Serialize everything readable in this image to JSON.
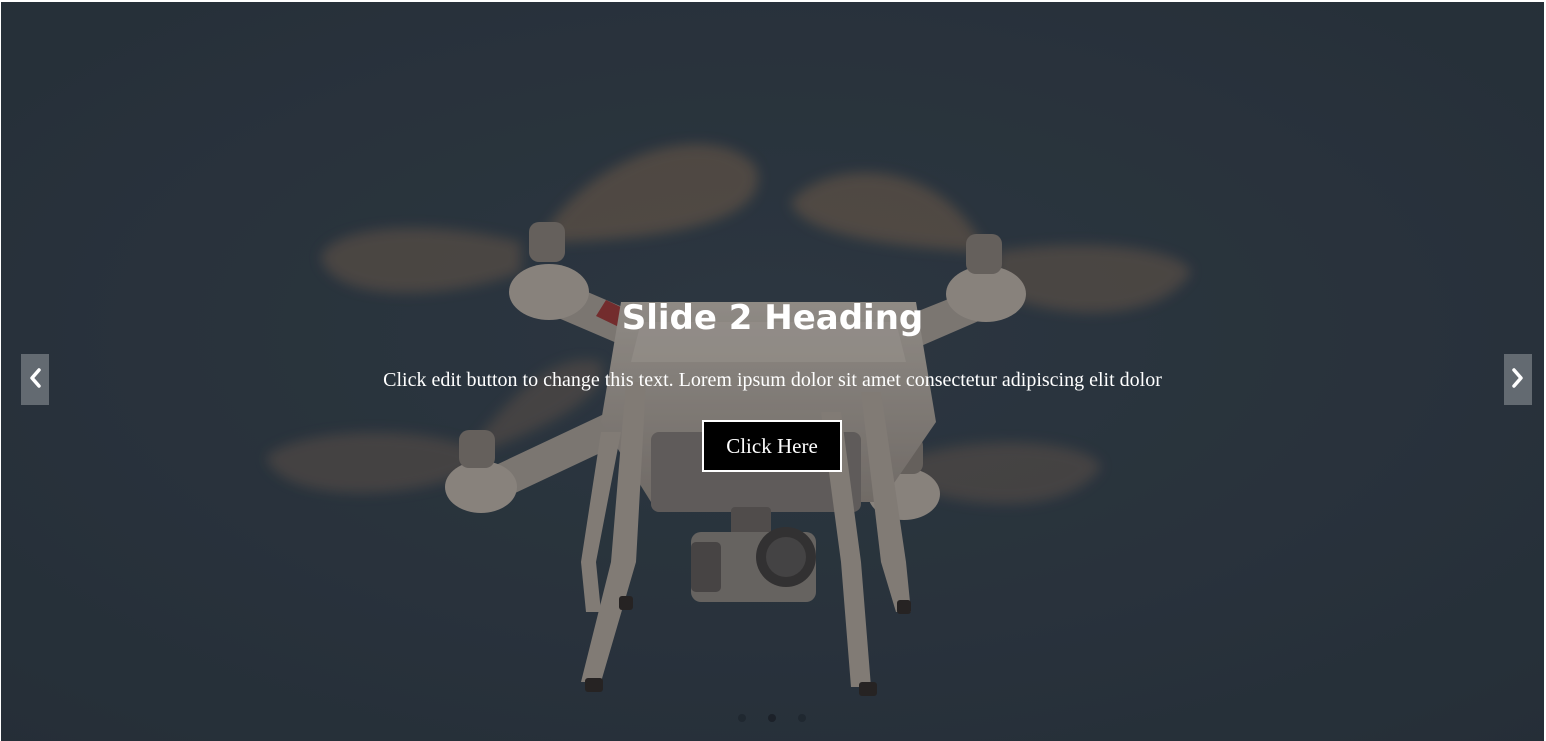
{
  "slider": {
    "heading": "Slide 2 Heading",
    "text": "Click edit button to change this text. Lorem ipsum dolor sit amet consectetur adipiscing elit dolor",
    "button_label": "Click Here",
    "prev_icon": "chevron-left-icon",
    "next_icon": "chevron-right-icon",
    "background_image": "drone-photo",
    "dots": [
      {
        "active": false
      },
      {
        "active": true
      },
      {
        "active": false
      }
    ],
    "colors": {
      "background": "#2e3843",
      "button_bg": "#000000",
      "button_border": "#ffffff",
      "text": "#ffffff"
    }
  }
}
